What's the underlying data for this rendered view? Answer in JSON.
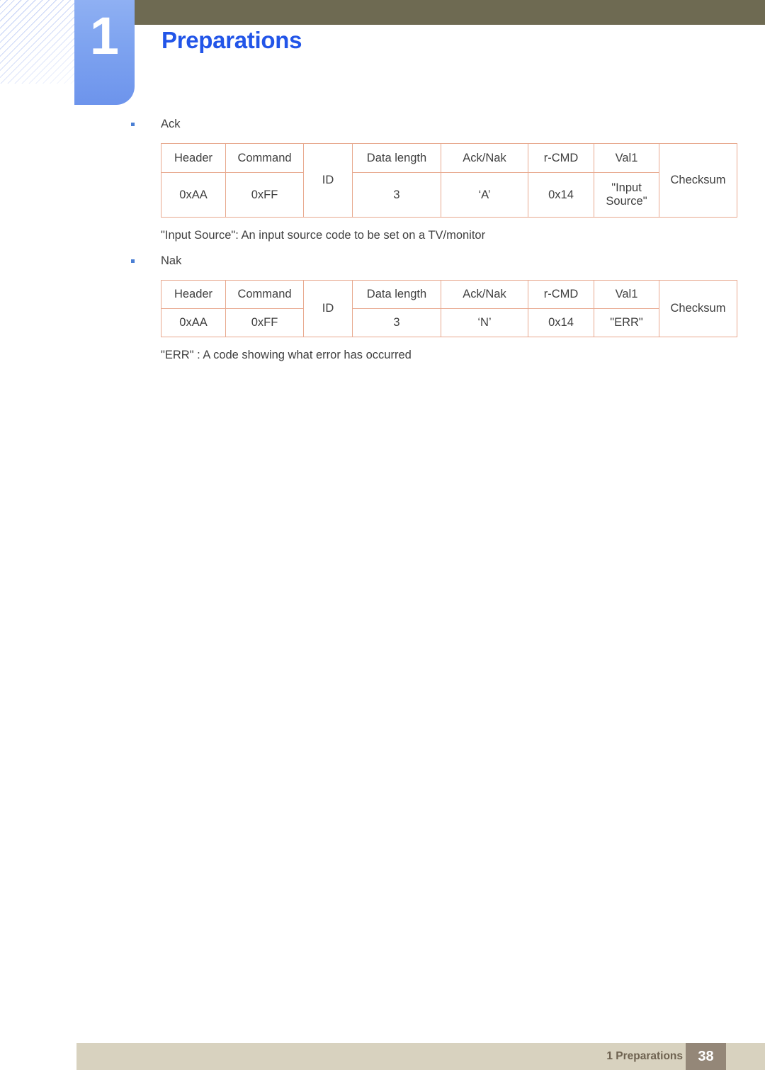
{
  "header": {
    "chapter_number": "1",
    "chapter_title": "Preparations",
    "accent_blue": "#2255e8",
    "tab_blue": "#7fa4f0",
    "olive_bar": "#6e6a52"
  },
  "content": {
    "ack_bullet": "Ack",
    "nak_bullet": "Nak",
    "ack_note": "\"Input Source\": An input source code to be set on a TV/monitor",
    "nak_note": "\"ERR\" : A code showing what error has occurred"
  },
  "ack_table": {
    "columns": [
      "Header",
      "Command",
      "ID",
      "Data length",
      "Ack/Nak",
      "r-CMD",
      "Val1",
      "Checksum"
    ],
    "header_row": {
      "header": "Header",
      "command": "Command",
      "id": "ID",
      "data_length": "Data length",
      "ack_nak": "Ack/Nak",
      "r_cmd": "r-CMD",
      "val1": "Val1",
      "checksum": "Checksum"
    },
    "value_row": {
      "header": "0xAA",
      "command": "0xFF",
      "data_length": "3",
      "ack_nak": "‘A’",
      "r_cmd": "0x14",
      "val1": "\"Input Source\""
    }
  },
  "nak_table": {
    "columns": [
      "Header",
      "Command",
      "ID",
      "Data length",
      "Ack/Nak",
      "r-CMD",
      "Val1",
      "Checksum"
    ],
    "header_row": {
      "header": "Header",
      "command": "Command",
      "id": "ID",
      "data_length": "Data length",
      "ack_nak": "Ack/Nak",
      "r_cmd": "r-CMD",
      "val1": "Val1",
      "checksum": "Checksum"
    },
    "value_row": {
      "header": "0xAA",
      "command": "0xFF",
      "data_length": "3",
      "ack_nak": "‘N’",
      "r_cmd": "0x14",
      "val1": "\"ERR\""
    }
  },
  "footer": {
    "label": "1 Preparations",
    "page_number": "38",
    "bar_color": "#d8d2bf",
    "page_box_color": "#948778"
  }
}
